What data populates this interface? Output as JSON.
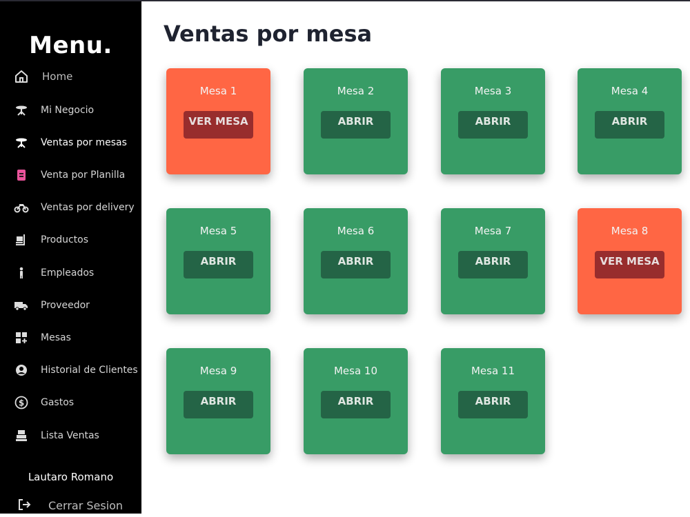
{
  "sidebar": {
    "brand": "Menu.",
    "items": [
      {
        "label": "Home",
        "icon": "home-icon"
      },
      {
        "label": "Mi Negocio",
        "icon": "table-icon"
      },
      {
        "label": "Ventas por mesas",
        "icon": "table-icon"
      },
      {
        "label": "Venta por Planilla",
        "icon": "sheet-icon"
      },
      {
        "label": "Ventas por delivery",
        "icon": "motorcycle-icon"
      },
      {
        "label": "Productos",
        "icon": "dolly-icon"
      },
      {
        "label": "Empleados",
        "icon": "person-icon"
      },
      {
        "label": "Proveedor",
        "icon": "truck-icon"
      },
      {
        "label": "Mesas",
        "icon": "grid-plus-icon"
      },
      {
        "label": "Historial de Clientes",
        "icon": "user-circle-icon"
      },
      {
        "label": "Gastos",
        "icon": "money-icon"
      },
      {
        "label": "Lista Ventas",
        "icon": "register-icon"
      }
    ],
    "user_name": "Lautaro Romano",
    "logout_label": "Cerrar Sesion"
  },
  "main": {
    "title": "Ventas por mesa",
    "tables": [
      {
        "name": "Mesa 1",
        "action": "VER MESA",
        "status": "busy"
      },
      {
        "name": "Mesa 2",
        "action": "ABRIR",
        "status": "free"
      },
      {
        "name": "Mesa 3",
        "action": "ABRIR",
        "status": "free"
      },
      {
        "name": "Mesa 4",
        "action": "ABRIR",
        "status": "free"
      },
      {
        "name": "Mesa 5",
        "action": "ABRIR",
        "status": "free"
      },
      {
        "name": "Mesa 6",
        "action": "ABRIR",
        "status": "free"
      },
      {
        "name": "Mesa 7",
        "action": "ABRIR",
        "status": "free"
      },
      {
        "name": "Mesa 8",
        "action": "VER MESA",
        "status": "busy"
      },
      {
        "name": "Mesa 9",
        "action": "ABRIR",
        "status": "free"
      },
      {
        "name": "Mesa 10",
        "action": "ABRIR",
        "status": "free"
      },
      {
        "name": "Mesa 11",
        "action": "ABRIR",
        "status": "free"
      }
    ]
  },
  "colors": {
    "free": "#389c66",
    "busy": "#ff6644",
    "free_button": "#246446",
    "busy_button": "#982d2d",
    "sidebar_bg": "#000000"
  }
}
